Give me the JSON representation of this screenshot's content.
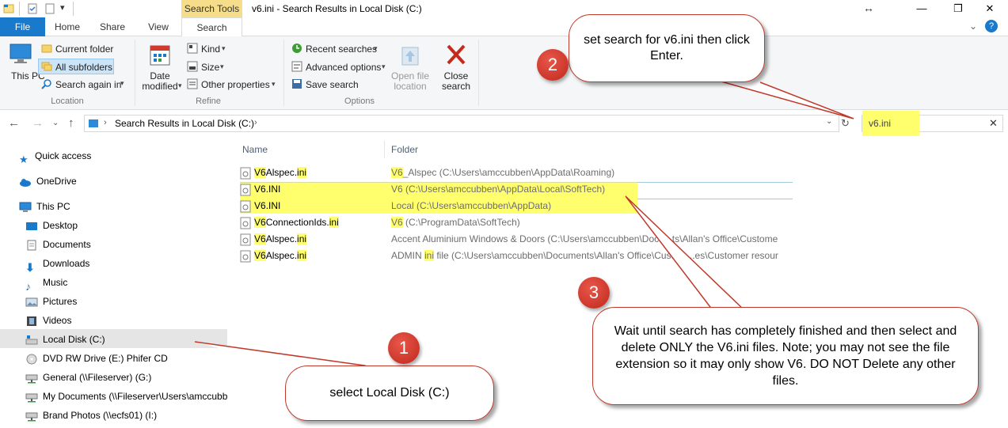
{
  "window": {
    "title": "v6.ini - Search Results in Local Disk (C:)",
    "context_tab": "Search Tools",
    "controls": {
      "minimize": "—",
      "resize_cursor": "↔",
      "maximize": "❐",
      "close": "✕",
      "help": "?"
    }
  },
  "ribbon_tabs": [
    "File",
    "Home",
    "Share",
    "View",
    "Search"
  ],
  "ribbon": {
    "location": {
      "this_pc": "This PC",
      "current_folder": "Current folder",
      "all_subfolders": "All subfolders",
      "search_again_in": "Search again in",
      "group": "Location"
    },
    "refine": {
      "date_modified": "Date modified",
      "kind": "Kind",
      "size": "Size",
      "other_properties": "Other properties",
      "group": "Refine"
    },
    "options": {
      "recent_searches": "Recent searches",
      "advanced_options": "Advanced options",
      "save_search": "Save search",
      "open_file_location": "Open file location",
      "close_search": "Close search",
      "group": "Options"
    }
  },
  "address": {
    "path": "Search Results in Local Disk (C:)",
    "search_value": "v6.ini"
  },
  "nav_pane": {
    "items": [
      {
        "label": "Quick access",
        "icon": "star-icon"
      },
      {
        "label": "OneDrive",
        "icon": "cloud-icon"
      },
      {
        "label": "This PC",
        "icon": "computer-icon"
      },
      {
        "label": "Desktop",
        "icon": "desktop-icon"
      },
      {
        "label": "Documents",
        "icon": "documents-icon"
      },
      {
        "label": "Downloads",
        "icon": "downloads-icon"
      },
      {
        "label": "Music",
        "icon": "music-icon"
      },
      {
        "label": "Pictures",
        "icon": "pictures-icon"
      },
      {
        "label": "Videos",
        "icon": "videos-icon"
      },
      {
        "label": "Local Disk (C:)",
        "icon": "drive-icon"
      },
      {
        "label": "DVD RW Drive (E:) Phifer CD",
        "icon": "dvd-icon"
      },
      {
        "label": "General (\\\\Fileserver) (G:)",
        "icon": "network-drive-icon"
      },
      {
        "label": "My Documents (\\\\Fileserver\\Users\\amccubb",
        "icon": "network-drive-icon"
      },
      {
        "label": "Brand Photos (\\\\ecfs01) (I:)",
        "icon": "network-drive-icon"
      }
    ]
  },
  "columns": {
    "name": "Name",
    "folder": "Folder"
  },
  "files": [
    {
      "name_pre": "V6",
      "name_mid": "Alspec.",
      "name_hl": "ini",
      "folder_hl": "V6",
      "folder_rest": "_Alspec (C:\\Users\\amccubben\\AppData\\Roaming)"
    },
    {
      "name_pre": "V6",
      "name_mid": ".",
      "name_hl": "INI",
      "folder_hl": "V6",
      "folder_rest": " (C:\\Users\\amccubben\\AppData\\Local\\SoftTech)"
    },
    {
      "name_pre": "V6",
      "name_mid": ".",
      "name_hl": "INI",
      "folder_hl": "",
      "folder_rest": "Local (C:\\Users\\amccubben\\AppData)"
    },
    {
      "name_pre": "V6",
      "name_mid": "ConnectionIds.",
      "name_hl": "ini",
      "folder_hl": "V6",
      "folder_rest": " (C:\\ProgramData\\SoftTech)"
    },
    {
      "name_pre": "V6",
      "name_mid": "Alspec.",
      "name_hl": "ini",
      "folder_hl": "",
      "folder_rest": "Accent Aluminium Windows & Doors (C:\\Users\\amccubben\\Docu...ts\\Allan's Office\\Custome"
    },
    {
      "name_pre": "V6",
      "name_mid": "Alspec.",
      "name_hl": "ini",
      "folder_hl": "ini",
      "folder_pre": "ADMIN ",
      "folder_rest": " file (C:\\Users\\amccubben\\Documents\\Allan's Office\\Custom...es\\Customer resour"
    }
  ],
  "callouts": {
    "one": {
      "number": "1",
      "text": "select Local Disk (C:)"
    },
    "two": {
      "number": "2",
      "text": "set search for v6.ini then click Enter."
    },
    "three": {
      "number": "3",
      "text": "Wait until search has completely finished and then select and delete ONLY the V6.ini files. Note; you may not see the file extension so it may only show V6. DO NOT Delete any other files."
    }
  },
  "colors": {
    "accent": "#1979ca",
    "highlight": "#ffff6e",
    "callout_border": "#c0392b",
    "badge": "#d13b2e"
  }
}
